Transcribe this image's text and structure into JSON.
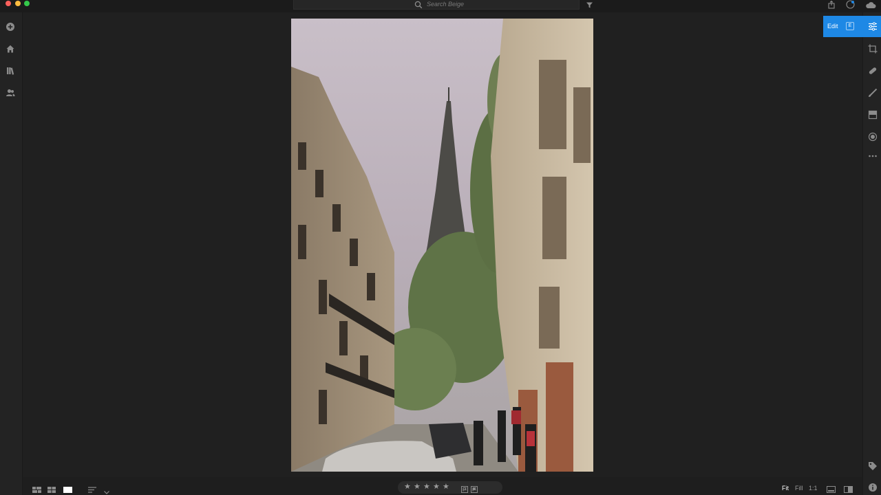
{
  "search": {
    "placeholder": "Search Beige"
  },
  "edit_panel": {
    "label": "Edit",
    "shortcut": "E"
  },
  "view": {
    "zoom_options": [
      "Fit",
      "Fill",
      "1:1"
    ],
    "active_zoom": "Fit"
  },
  "rating": {
    "stars": 0,
    "max_stars": 5
  },
  "colors": {
    "accent": "#1e88e5",
    "background": "#1e1e1e",
    "panel": "#232323",
    "icon": "#8c8c8c"
  },
  "left_rail_icons": [
    "add-photos-icon",
    "home-icon",
    "library-icon",
    "people-icon"
  ],
  "right_rail_icons": [
    "edit-sliders-icon",
    "crop-icon",
    "healing-icon",
    "brush-icon",
    "linear-gradient-icon",
    "radial-gradient-icon",
    "more-icon",
    "tag-icon",
    "info-icon"
  ],
  "top_right_icons": [
    "share-icon",
    "help-icon",
    "cloud-icon"
  ],
  "bottom_left_icons": [
    "photo-grid-icon",
    "square-grid-icon",
    "detail-view-icon",
    "sort-icon",
    "chevron-down-icon"
  ],
  "bottom_right_icons": [
    "filmstrip-icon",
    "compare-icon"
  ]
}
